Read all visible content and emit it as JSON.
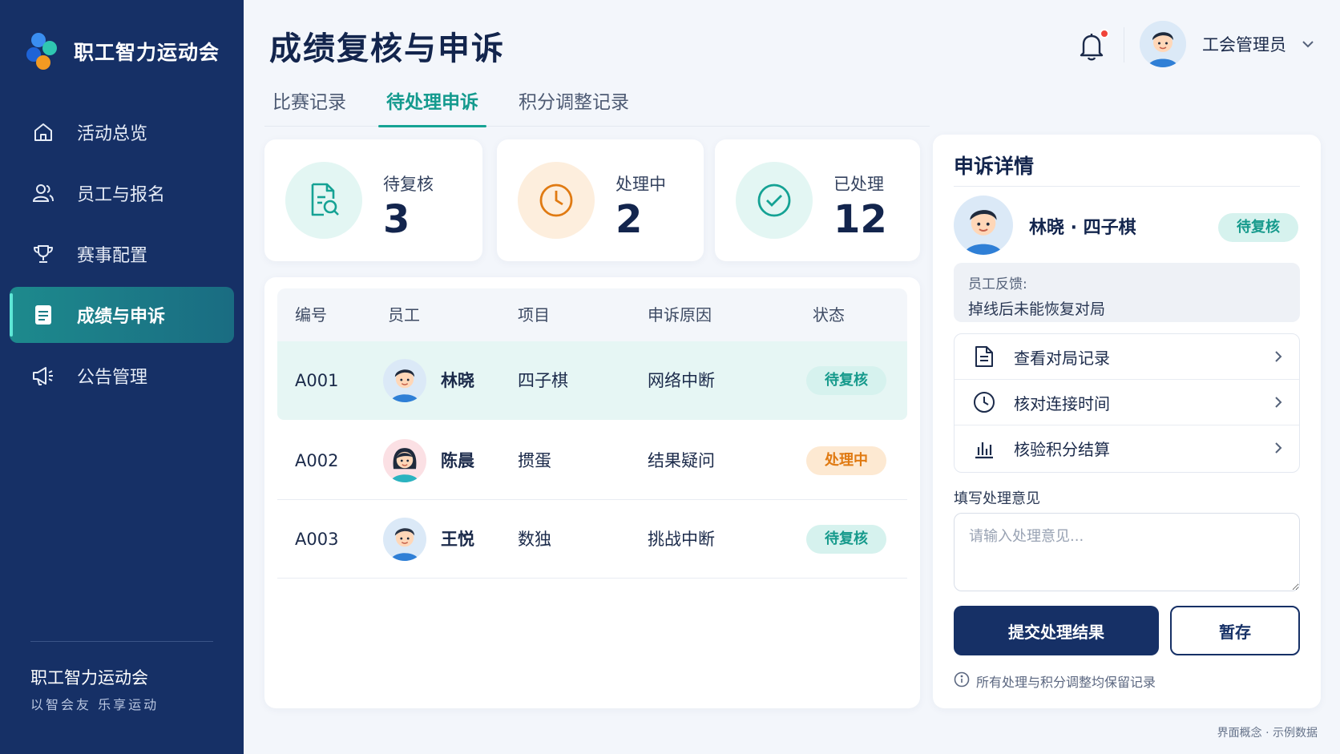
{
  "brand": {
    "name": "职工智力运动会"
  },
  "sidebar": {
    "items": [
      {
        "label": "活动总览",
        "icon": "home-icon",
        "active": false
      },
      {
        "label": "员工与报名",
        "icon": "users-icon",
        "active": false
      },
      {
        "label": "赛事配置",
        "icon": "trophy-icon",
        "active": false
      },
      {
        "label": "成绩与申诉",
        "icon": "document-icon",
        "active": true
      },
      {
        "label": "公告管理",
        "icon": "megaphone-icon",
        "active": false
      }
    ],
    "footer_title": "职工智力运动会",
    "footer_sub": "以智会友 乐享运动"
  },
  "header": {
    "title": "成绩复核与申诉",
    "user_name": "工会管理员"
  },
  "tabs": [
    {
      "label": "比赛记录",
      "active": false
    },
    {
      "label": "待处理申诉",
      "active": true
    },
    {
      "label": "积分调整记录",
      "active": false
    }
  ],
  "stats": [
    {
      "label": "待复核",
      "value": "3",
      "icon": "document-search-icon",
      "color": "#15a294",
      "bg": "#e3f6f3"
    },
    {
      "label": "处理中",
      "value": "2",
      "icon": "clock-icon",
      "color": "#e07a12",
      "bg": "#fdeedd"
    },
    {
      "label": "已处理",
      "value": "12",
      "icon": "check-circle-icon",
      "color": "#15a294",
      "bg": "#e3f6f3"
    }
  ],
  "table": {
    "headers": [
      "编号",
      "员工",
      "项目",
      "申诉原因",
      "状态"
    ],
    "rows": [
      {
        "id": "A001",
        "name": "林晓",
        "project": "四子棋",
        "reason": "网络中断",
        "status": "待复核",
        "status_type": "pending",
        "gender": "male",
        "selected": true
      },
      {
        "id": "A002",
        "name": "陈晨",
        "project": "掼蛋",
        "reason": "结果疑问",
        "status": "处理中",
        "status_type": "processing",
        "gender": "female",
        "selected": false
      },
      {
        "id": "A003",
        "name": "王悦",
        "project": "数独",
        "reason": "挑战中断",
        "status": "待复核",
        "status_type": "pending",
        "gender": "male",
        "selected": false
      }
    ]
  },
  "detail": {
    "title": "申诉详情",
    "name_line": "林晓 · 四子棋",
    "status": "待复核",
    "feedback_label": "员工反馈:",
    "feedback_text": "掉线后未能恢复对局",
    "actions": [
      {
        "label": "查看对局记录",
        "icon": "file-icon"
      },
      {
        "label": "核对连接时间",
        "icon": "clock-icon"
      },
      {
        "label": "核验积分结算",
        "icon": "bar-chart-icon"
      }
    ],
    "opinion_label": "填写处理意见",
    "opinion_placeholder": "请输入处理意见...",
    "opinion_value": "",
    "submit_label": "提交处理结果",
    "save_label": "暂存",
    "note": "所有处理与积分调整均保留记录"
  },
  "corner_note": "界面概念 · 示例数据",
  "colors": {
    "sidebar": "#163066",
    "accent": "#16a394",
    "warning": "#e07a12",
    "notification": "#f0443a"
  }
}
